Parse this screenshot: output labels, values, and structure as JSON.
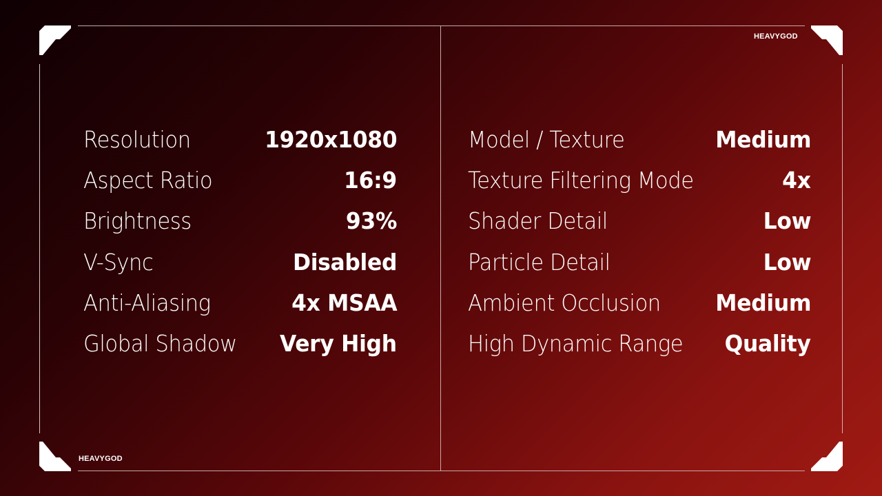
{
  "brand": {
    "top_right": "HEAVYGOD",
    "bottom_left": "HEAVYGOD"
  },
  "colors": {
    "background_start": "#0f0003",
    "background_end": "#a01a13",
    "text": "#ffffff",
    "frame_line": "#c9a8a8"
  },
  "settings": {
    "left": [
      {
        "label": "Resolution",
        "value": "1920x1080"
      },
      {
        "label": "Aspect Ratio",
        "value": "16:9"
      },
      {
        "label": "Brightness",
        "value": "93%"
      },
      {
        "label": "V-Sync",
        "value": "Disabled"
      },
      {
        "label": "Anti-Aliasing",
        "value": "4x MSAA"
      },
      {
        "label": "Global Shadow",
        "value": "Very High"
      }
    ],
    "right": [
      {
        "label": "Model / Texture",
        "value": "Medium"
      },
      {
        "label": "Texture Filtering Mode",
        "value": "4x"
      },
      {
        "label": "Shader Detail",
        "value": "Low"
      },
      {
        "label": "Particle Detail",
        "value": "Low"
      },
      {
        "label": "Ambient Occlusion",
        "value": "Medium"
      },
      {
        "label": "High Dynamic Range",
        "value": "Quality"
      }
    ]
  }
}
